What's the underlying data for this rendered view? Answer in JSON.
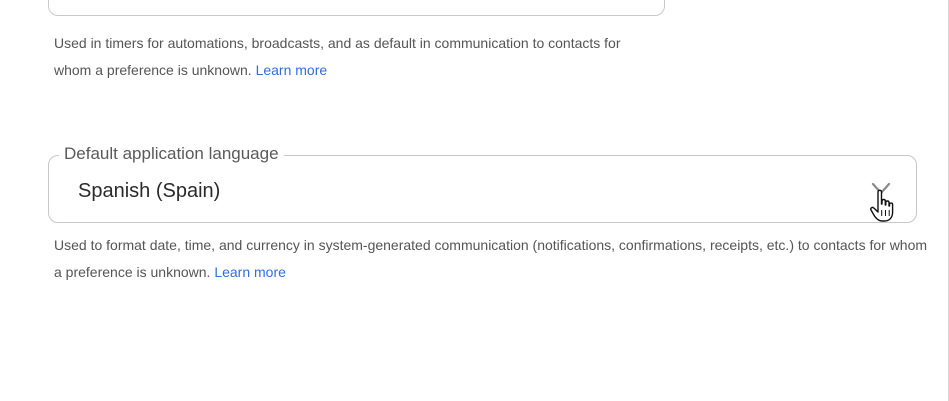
{
  "previous_field": {
    "helper_text": "Used in timers for automations, broadcasts, and as default in communication to contacts for whom a preference is unknown.",
    "learn_more_label": "Learn more"
  },
  "language_field": {
    "label": "Default application language",
    "value": "Spanish (Spain)",
    "helper_text": "Used to format date, time, and currency in system-generated communication (notifications, confirmations, receipts, etc.) to contacts for whom a preference is unknown.",
    "learn_more_label": "Learn more"
  },
  "icons": {
    "dropdown": "chevron-down-icon",
    "cursor": "hand-pointer-cursor"
  },
  "colors": {
    "link": "#2f6fe0",
    "border": "#c7c7c7",
    "text": "#2b2b2b"
  }
}
